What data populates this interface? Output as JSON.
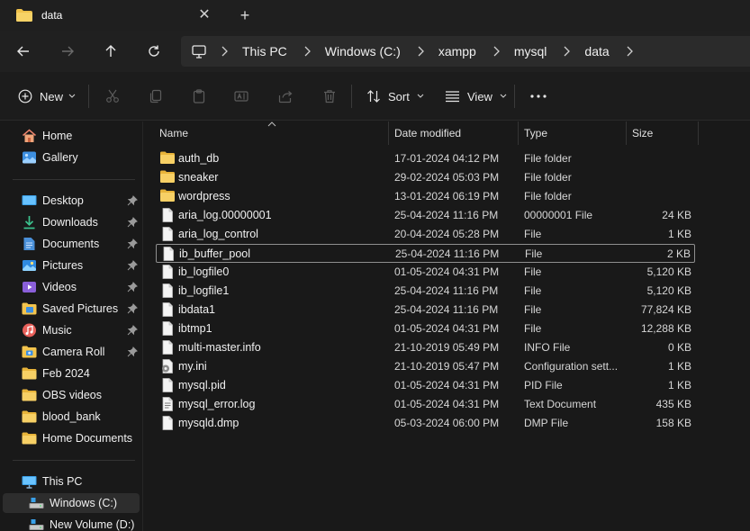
{
  "tab": {
    "title": "data",
    "close": "✕",
    "new": "+"
  },
  "breadcrumb": [
    "This PC",
    "Windows (C:)",
    "xampp",
    "mysql",
    "data"
  ],
  "toolbar": {
    "new_label": "New",
    "sort_label": "Sort",
    "view_label": "View",
    "more": "···"
  },
  "sidebar": {
    "top": [
      {
        "label": "Home",
        "icon": "home-icon"
      },
      {
        "label": "Gallery",
        "icon": "gallery-icon"
      }
    ],
    "quick": [
      {
        "label": "Desktop",
        "icon": "desktop-icon",
        "pinned": true
      },
      {
        "label": "Downloads",
        "icon": "download-icon",
        "pinned": true
      },
      {
        "label": "Documents",
        "icon": "documents-icon",
        "pinned": true
      },
      {
        "label": "Pictures",
        "icon": "pictures-icon",
        "pinned": true
      },
      {
        "label": "Videos",
        "icon": "videos-icon",
        "pinned": true
      },
      {
        "label": "Saved Pictures",
        "icon": "saved-pictures-icon",
        "pinned": true
      },
      {
        "label": "Music",
        "icon": "music-icon",
        "pinned": true
      },
      {
        "label": "Camera Roll",
        "icon": "camera-roll-icon",
        "pinned": true
      },
      {
        "label": "Feb 2024",
        "icon": "folder-icon",
        "pinned": false
      },
      {
        "label": "OBS videos",
        "icon": "folder-icon",
        "pinned": false
      },
      {
        "label": "blood_bank",
        "icon": "folder-icon",
        "pinned": false
      },
      {
        "label": "Home Documents",
        "icon": "folder-icon",
        "pinned": false
      }
    ],
    "drives": [
      {
        "label": "This PC",
        "icon": "this-pc-icon"
      },
      {
        "label": "Windows (C:)",
        "icon": "drive-icon",
        "selected": true
      },
      {
        "label": "New Volume (D:)",
        "icon": "drive-icon"
      }
    ]
  },
  "columns": {
    "name": "Name",
    "date": "Date modified",
    "type": "Type",
    "size": "Size"
  },
  "files": [
    {
      "name": "auth_db",
      "date": "17-01-2024 04:12 PM",
      "type": "File folder",
      "size": "",
      "kind": "folder"
    },
    {
      "name": "sneaker",
      "date": "29-02-2024 05:03 PM",
      "type": "File folder",
      "size": "",
      "kind": "folder"
    },
    {
      "name": "wordpress",
      "date": "13-01-2024 06:19 PM",
      "type": "File folder",
      "size": "",
      "kind": "folder"
    },
    {
      "name": "aria_log.00000001",
      "date": "25-04-2024 11:16 PM",
      "type": "00000001 File",
      "size": "24 KB",
      "kind": "file"
    },
    {
      "name": "aria_log_control",
      "date": "20-04-2024 05:28 PM",
      "type": "File",
      "size": "1 KB",
      "kind": "file"
    },
    {
      "name": "ib_buffer_pool",
      "date": "25-04-2024 11:16 PM",
      "type": "File",
      "size": "2 KB",
      "kind": "file",
      "focused": true
    },
    {
      "name": "ib_logfile0",
      "date": "01-05-2024 04:31 PM",
      "type": "File",
      "size": "5,120 KB",
      "kind": "file"
    },
    {
      "name": "ib_logfile1",
      "date": "25-04-2024 11:16 PM",
      "type": "File",
      "size": "5,120 KB",
      "kind": "file"
    },
    {
      "name": "ibdata1",
      "date": "25-04-2024 11:16 PM",
      "type": "File",
      "size": "77,824 KB",
      "kind": "file"
    },
    {
      "name": "ibtmp1",
      "date": "01-05-2024 04:31 PM",
      "type": "File",
      "size": "12,288 KB",
      "kind": "file"
    },
    {
      "name": "multi-master.info",
      "date": "21-10-2019 05:49 PM",
      "type": "INFO File",
      "size": "0 KB",
      "kind": "file"
    },
    {
      "name": "my.ini",
      "date": "21-10-2019 05:47 PM",
      "type": "Configuration sett...",
      "size": "1 KB",
      "kind": "config"
    },
    {
      "name": "mysql.pid",
      "date": "01-05-2024 04:31 PM",
      "type": "PID File",
      "size": "1 KB",
      "kind": "file"
    },
    {
      "name": "mysql_error.log",
      "date": "01-05-2024 04:31 PM",
      "type": "Text Document",
      "size": "435 KB",
      "kind": "text"
    },
    {
      "name": "mysqld.dmp",
      "date": "05-03-2024 06:00 PM",
      "type": "DMP File",
      "size": "158 KB",
      "kind": "file"
    }
  ]
}
